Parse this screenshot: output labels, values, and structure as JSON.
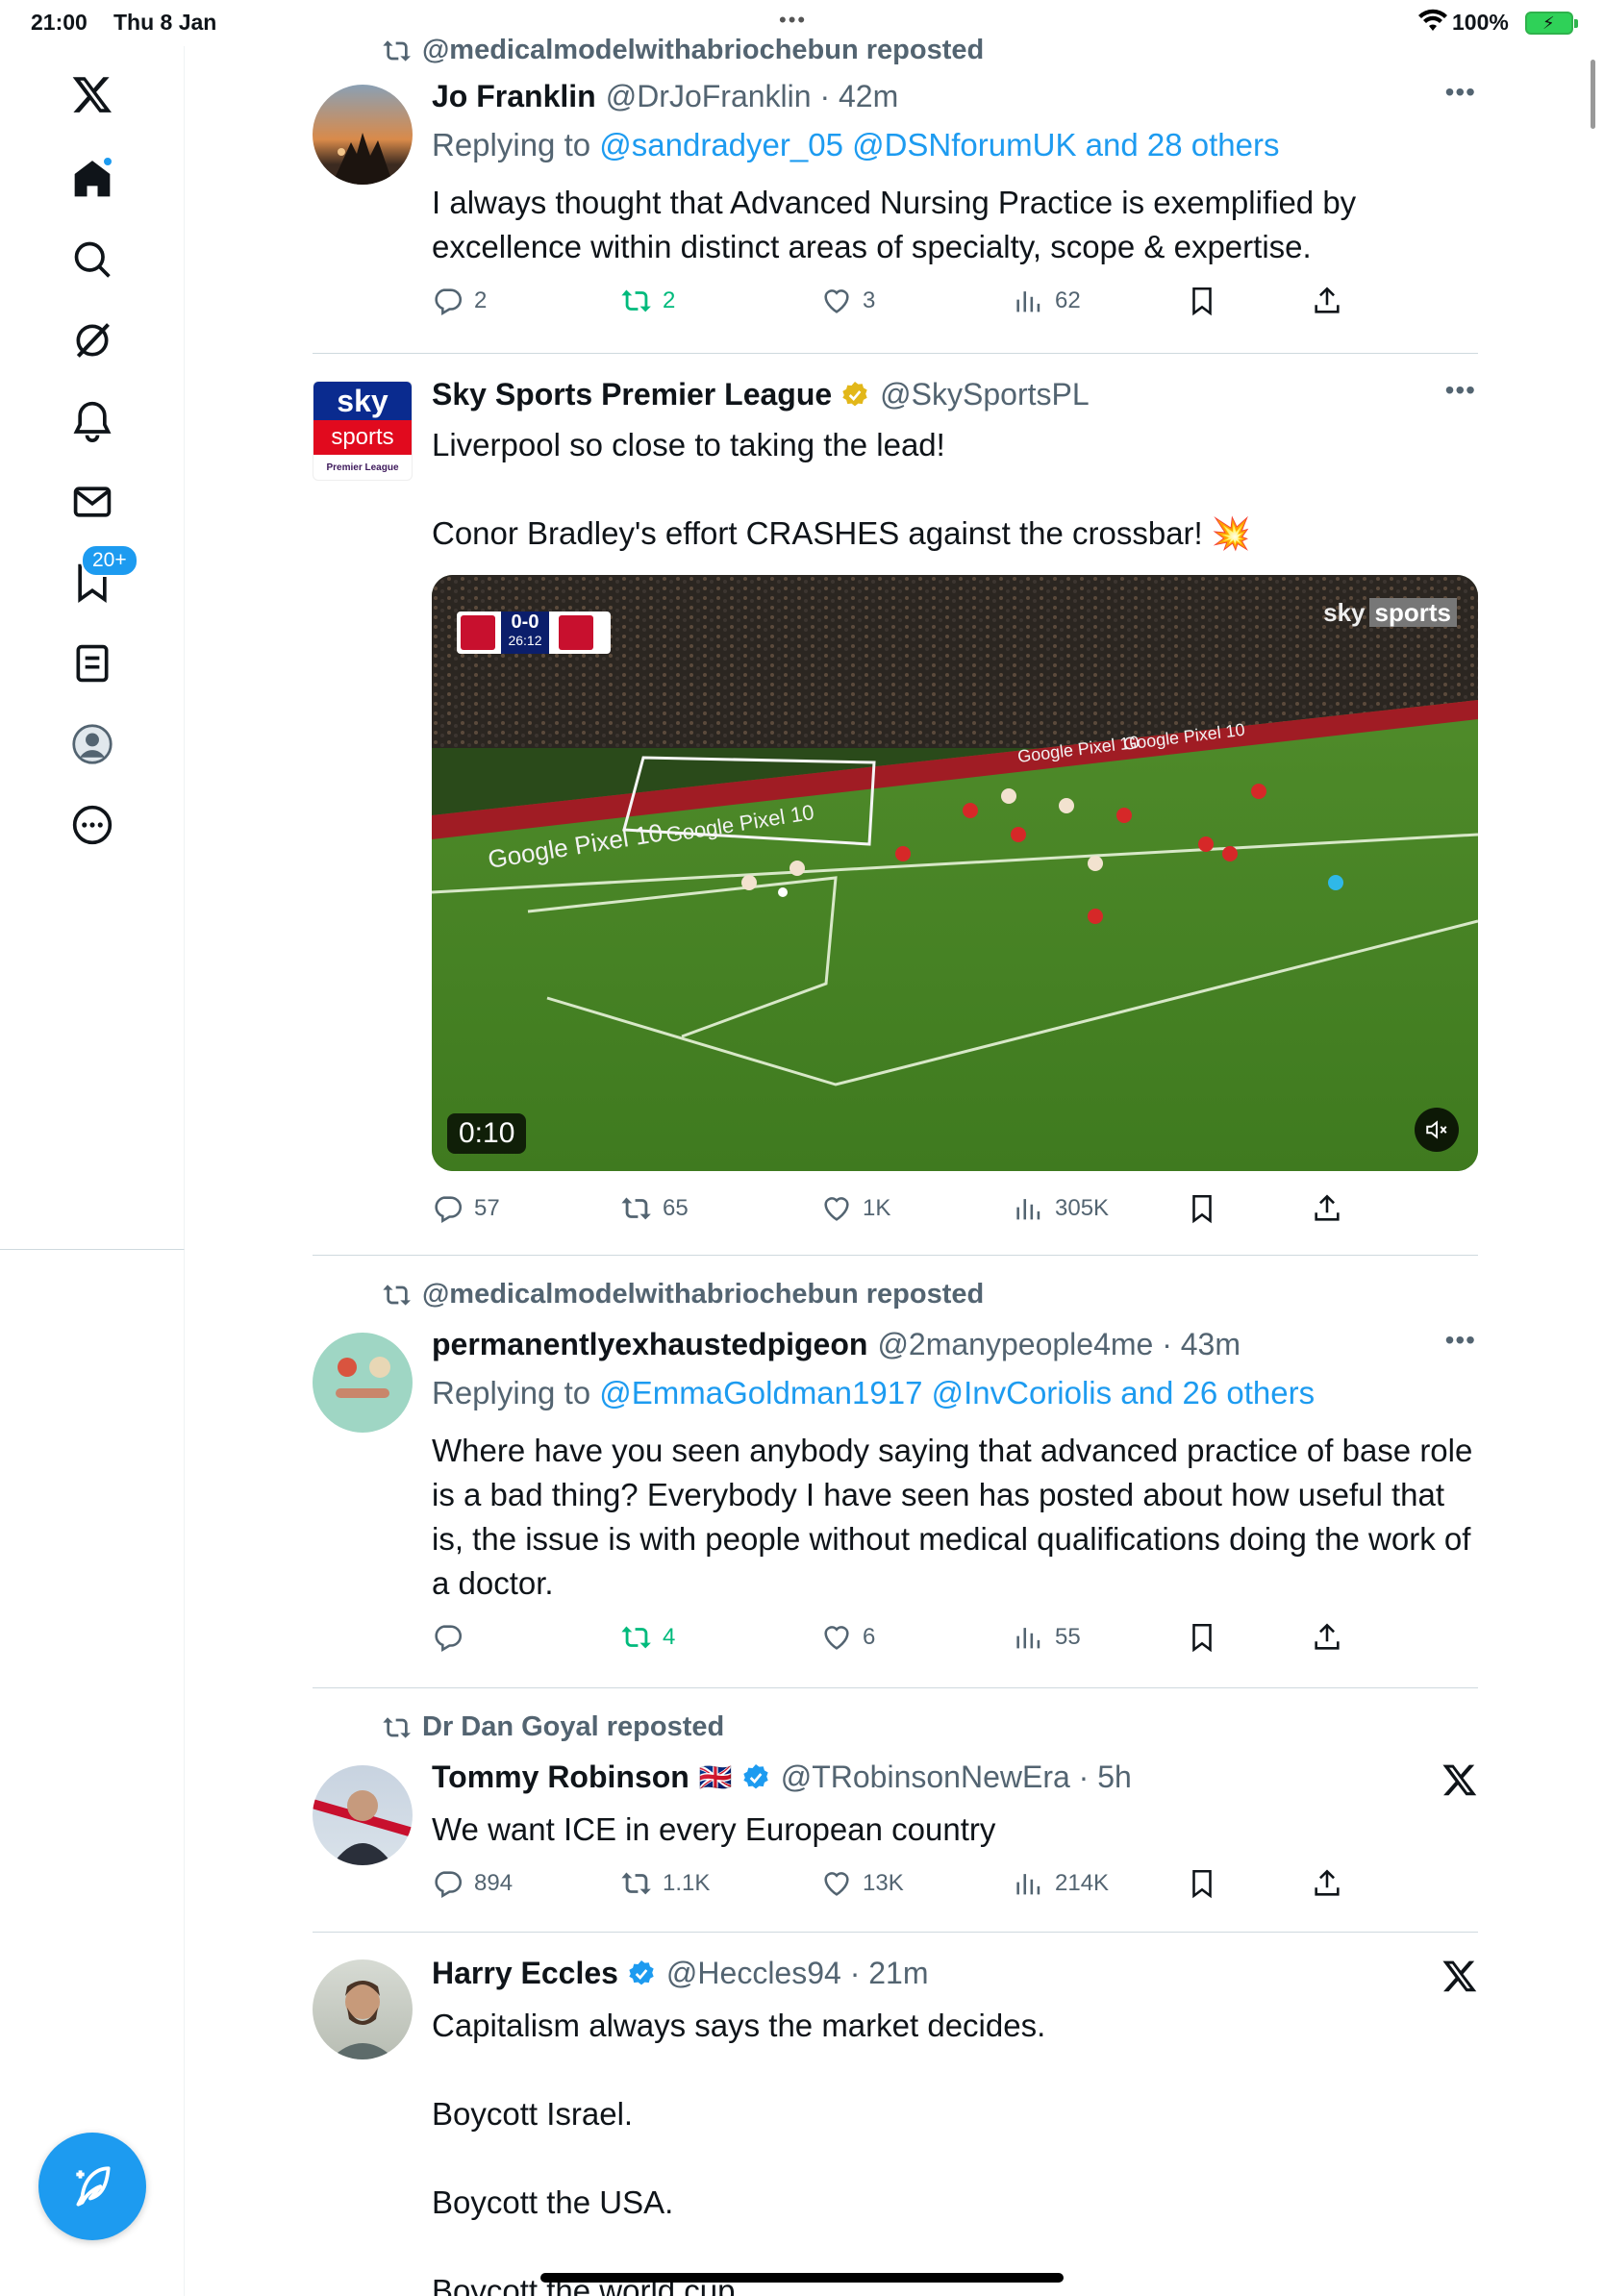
{
  "status_bar": {
    "time": "21:00",
    "date": "Thu 8 Jan",
    "battery": "100%",
    "dots": "•••"
  },
  "sidebar": {
    "items": [
      {
        "icon": "x-logo-icon"
      },
      {
        "icon": "home-icon",
        "has_dot": true
      },
      {
        "icon": "search-icon"
      },
      {
        "icon": "grok-icon"
      },
      {
        "icon": "notifications-icon",
        "badge": "20+"
      },
      {
        "icon": "messages-icon"
      },
      {
        "icon": "bookmarks-icon"
      },
      {
        "icon": "lists-icon"
      },
      {
        "icon": "profile-icon"
      },
      {
        "icon": "more-icon"
      }
    ],
    "notification_badge": "20+"
  },
  "colors": {
    "accent": "#1d9bf0",
    "text": "#0f1419",
    "muted": "#536471",
    "repost_green": "#00ba7c",
    "gold_check": "#e2b719"
  },
  "tweets": [
    {
      "repost_by": "@medicalmodelwithabriochebun reposted",
      "name": "Jo Franklin",
      "handle_time": "@DrJoFranklin · 42m",
      "reply_prefix": "Replying to ",
      "reply_targets": "@sandradyer_05 @DSNforumUK and 28 others",
      "text": "I always thought that Advanced Nursing Practice is exemplified by excellence within distinct areas of specialty, scope & expertise.",
      "replies": "2",
      "reposts": "2",
      "likes": "3",
      "views": "62"
    },
    {
      "name": "Sky Sports Premier League",
      "handle": "@SkySportsPL",
      "avatar_text": {
        "top": "sky",
        "middle": "sports",
        "bottom": "Premier League"
      },
      "text": "Liverpool so close to taking the lead!\n\nConor Bradley's effort CRASHES against the crossbar! 💥",
      "video": {
        "score": "0-0",
        "clock": "26:12",
        "duration": "0:10",
        "brand": "sky",
        "brand2": "sports",
        "ad_text": "Google Pixel 10"
      },
      "replies": "57",
      "reposts": "65",
      "likes": "1K",
      "views": "305K"
    },
    {
      "repost_by": "@medicalmodelwithabriochebun reposted",
      "name": "permanentlyexhaustedpigeon",
      "handle_time": "@2manypeople4me · 43m",
      "reply_prefix": "Replying to ",
      "reply_targets": "@EmmaGoldman1917 @InvCoriolis and 26 others",
      "text": "Where have you seen anybody saying that advanced practice of base role is a bad thing? Everybody I have seen has posted about how useful that is, the issue is with people without medical qualifications doing the work of a doctor.",
      "replies": "",
      "reposts": "4",
      "likes": "6",
      "views": "55"
    },
    {
      "repost_by": "Dr Dan Goyal reposted",
      "name": "Tommy Robinson",
      "flag": "🇬🇧",
      "handle_time": "@TRobinsonNewEra · 5h",
      "text": "We want ICE in every European country",
      "replies": "894",
      "reposts": "1.1K",
      "likes": "13K",
      "views": "214K"
    },
    {
      "name": "Harry Eccles",
      "handle_time": "@Heccles94 · 21m",
      "text": "Capitalism always says the market decides.\n\nBoycott Israel.\n\nBoycott the USA.\n\nBoycott the world cup"
    }
  ]
}
